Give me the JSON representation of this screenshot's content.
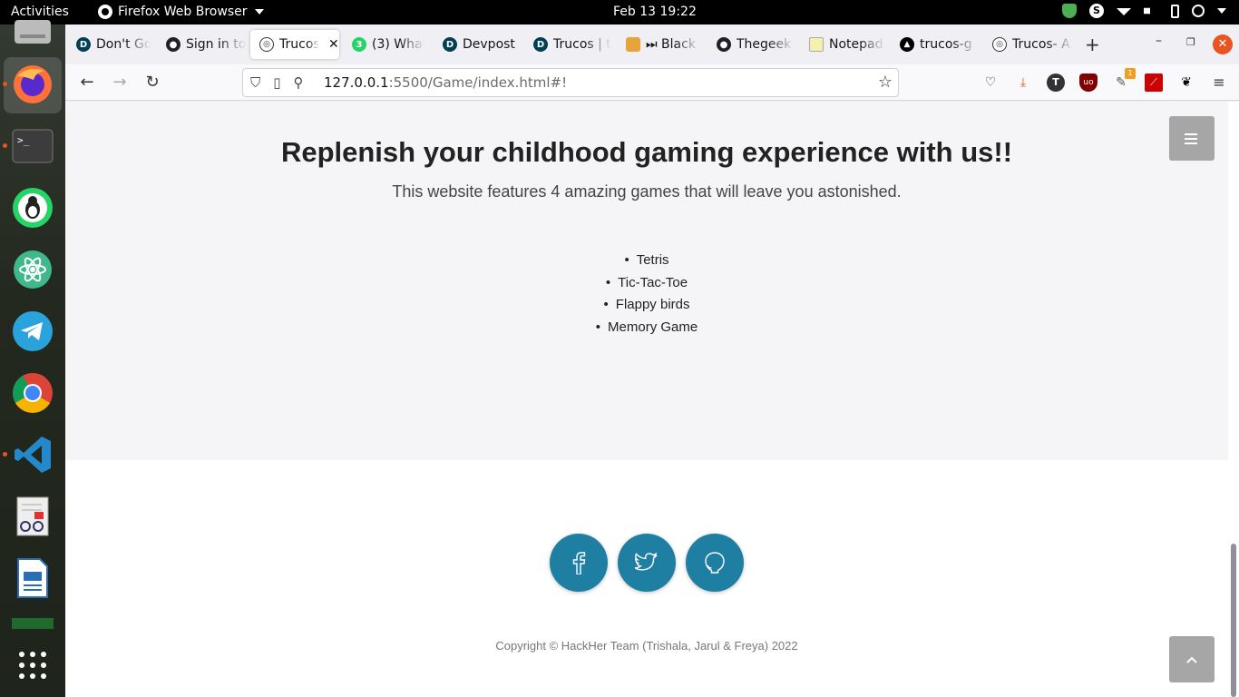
{
  "system": {
    "activities": "Activities",
    "app_name": "Firefox Web Browser",
    "clock": "Feb 13  19:22"
  },
  "tabs": [
    {
      "label": "Don't Go",
      "icon": "devpost-icon",
      "active": false
    },
    {
      "label": "Sign in to",
      "icon": "github-icon",
      "active": false
    },
    {
      "label": "Trucos",
      "icon": "globe-icon",
      "active": true
    },
    {
      "label": "(3) What",
      "icon": "whatsapp-icon",
      "active": false
    },
    {
      "label": "Devpost",
      "icon": "devpost-icon",
      "active": false
    },
    {
      "label": "Trucos | t",
      "icon": "devpost-icon",
      "active": false
    },
    {
      "label": "⏭ Black",
      "icon": "bookmark-icon",
      "active": false
    },
    {
      "label": "Thegeek",
      "icon": "github-icon",
      "active": false
    },
    {
      "label": "Notepad",
      "icon": "notepad-icon",
      "active": false
    },
    {
      "label": "trucos-g",
      "icon": "vercel-icon",
      "active": false
    },
    {
      "label": "Trucos- A",
      "icon": "globe-icon",
      "active": false
    }
  ],
  "urlbar": {
    "host": "127.0.0.1",
    "path": ":5500/Game/index.html#!"
  },
  "toolbar": {
    "download_badge": "1"
  },
  "page": {
    "heading": "Replenish your childhood gaming experience with us!!",
    "subheading": "This website features 4 amazing games that will leave you astonished.",
    "games": [
      "Tetris",
      "Tic-Tac-Toe",
      "Flappy birds",
      "Memory Game"
    ],
    "copyright": "Copyright © HackHer Team (Trishala, Jarul & Freya) 2022"
  },
  "colors": {
    "social_bg": "#1f7fa3",
    "button_gray": "#a6a6a6",
    "close_orange": "#e95420"
  }
}
